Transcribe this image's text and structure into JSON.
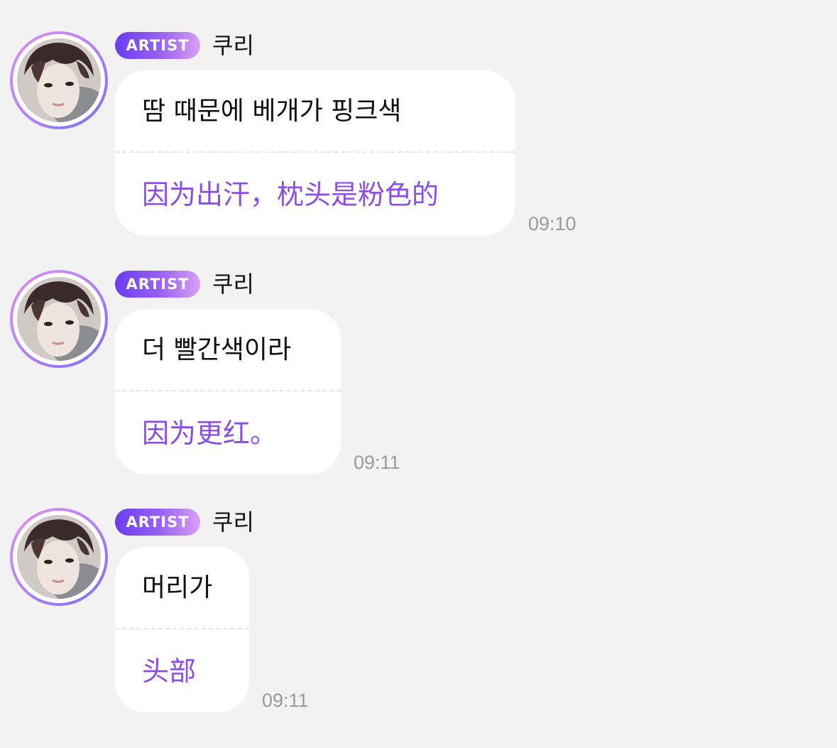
{
  "chat": {
    "messages": [
      {
        "badge": "ARTIST",
        "sender": "쿠리",
        "original": "땀 때문에 베개가 핑크색",
        "translation": "因为出汗，枕头是粉色的",
        "time": "09:10"
      },
      {
        "badge": "ARTIST",
        "sender": "쿠리",
        "original": "더 빨간색이라",
        "translation": "因为更红。",
        "time": "09:11"
      },
      {
        "badge": "ARTIST",
        "sender": "쿠리",
        "original": "머리가",
        "translation": "头部",
        "time": "09:11"
      }
    ]
  },
  "colors": {
    "background": "#f2f2f2",
    "bubble": "#ffffff",
    "translation_text": "#8b4de6",
    "badge_gradient_start": "#6a3cf0",
    "badge_gradient_end": "#d7a0f3",
    "timestamp": "#9a9a9a"
  },
  "icons": {
    "avatar": "artist-profile-photo"
  }
}
